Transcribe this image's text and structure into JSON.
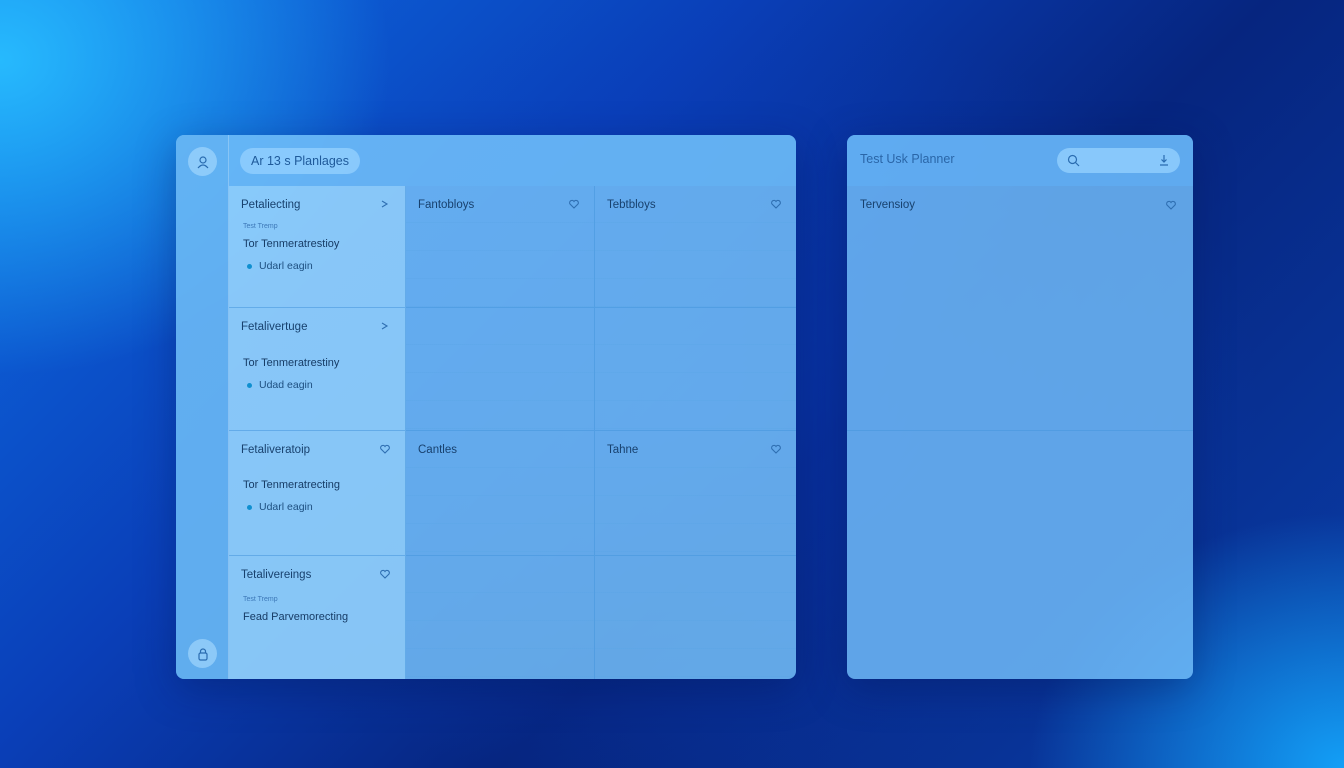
{
  "main": {
    "header_pill": "Ar 13 s Planlages",
    "columns": [
      {
        "title": "Fantobloys"
      },
      {
        "title": "Tebtbloys"
      }
    ],
    "rows": [
      {
        "title": "Petaliecting",
        "sub": "Test Tremp",
        "line": "Tor Tenmeratrestioy",
        "status": "Udarl eagin",
        "icon": "chevron-right-icon"
      },
      {
        "title": "Fetalivertuge",
        "sub": "",
        "line": "Tor Tenmeratrestiny",
        "status": "Udad eagin",
        "icon": "chevron-right-icon"
      },
      {
        "title": "Fetaliveratoip",
        "sub": "",
        "line": "Tor Tenmeratrecting",
        "status": "Udarl eagin",
        "icon": "heart-icon"
      },
      {
        "title": "Tetalivereings",
        "sub": "Test Tremp",
        "line": "Fead Parvemorecting",
        "status": "",
        "icon": "heart-icon"
      }
    ],
    "row3_cells": [
      "Cantles",
      "Tahne"
    ]
  },
  "side": {
    "title": "Test Usk Planner",
    "row_title": "Tervensioy"
  },
  "colors": {
    "accent": "#0f8fd0",
    "text_dark": "#18416e",
    "panel": "#78c3fa"
  }
}
